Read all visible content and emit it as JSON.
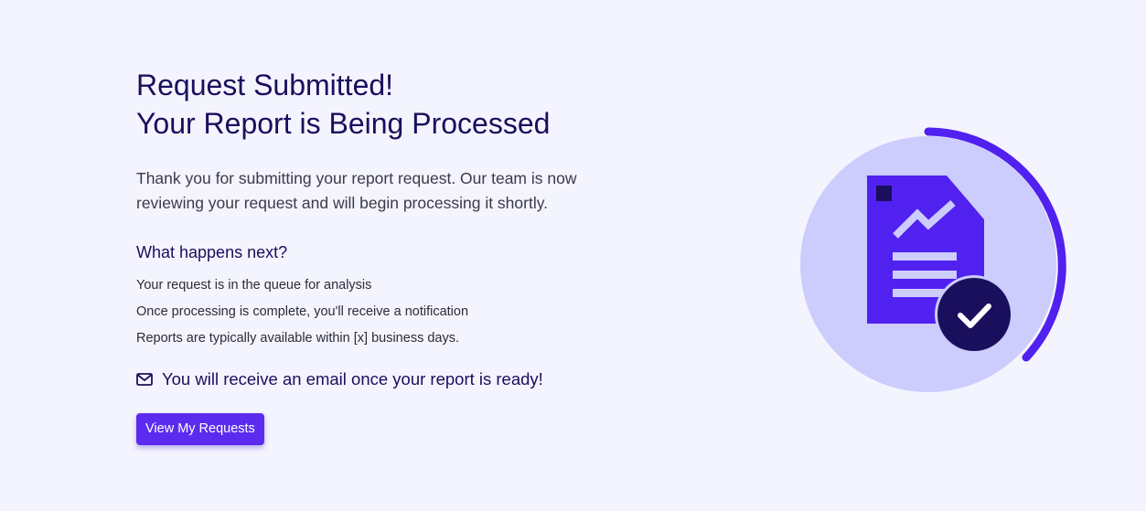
{
  "heading": {
    "line1": "Request Submitted!",
    "line2": "Your Report is Being Processed"
  },
  "intro": "Thank you for submitting your report request. Our team is now reviewing your request and will begin processing it shortly.",
  "next": {
    "heading": "What happens next?",
    "steps": [
      "Your request is in the queue for analysis",
      "Once processing is complete, you'll receive a notification",
      "Reports are typically available within [x] business days."
    ]
  },
  "email_note": {
    "icon": "mail-icon",
    "text": "You will receive an email once your report is ready!"
  },
  "button": {
    "label": "View My Requests"
  },
  "illustration": {
    "icons": [
      "report-document-icon",
      "trend-chart-icon",
      "check-icon"
    ],
    "colors": {
      "page_background": "#f4f4fe",
      "circle": "#ccccfd",
      "accent": "#5121f0",
      "dark": "#1a0f5c"
    }
  }
}
